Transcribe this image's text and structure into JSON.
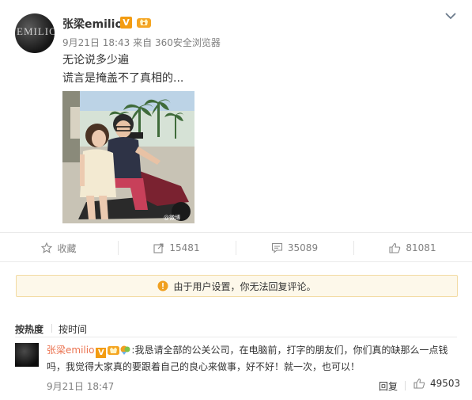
{
  "post": {
    "author": "张梁emilio",
    "avatar_text": "EMILIO",
    "date": "9月21日 18:43",
    "source": "来自 360安全浏览器",
    "text_lines": [
      "无论说多少遍",
      "谎言是掩盖不了真相的..."
    ],
    "watermark": "@微博"
  },
  "actions": {
    "favorite_label": "收藏",
    "repost_count": "15481",
    "comment_count": "35089",
    "like_count": "81081"
  },
  "notice": {
    "text": "由于用户设置，你无法回复评论。"
  },
  "sort_tabs": {
    "hot": "按热度",
    "time": "按时间"
  },
  "comment": {
    "author": "张梁emilio",
    "text": ":我恳请全部的公关公司，在电脑前，打字的朋友们，你们真的缺那么一点钱吗，我觉得大家真的要跟着自己的良心来做事，好不好！就一次，也可以！",
    "time": "9月21日 18:47",
    "reply_label": "回复",
    "like_count": "49503"
  },
  "colors": {
    "accent": "#eb7350",
    "verified": "#f39c12",
    "notice_bg": "#fdf8ea",
    "notice_icon": "#f0a020"
  },
  "icons": [
    "chevron-down-icon",
    "star-icon",
    "repost-icon",
    "comment-icon",
    "thumbs-up-icon",
    "warning-icon"
  ]
}
